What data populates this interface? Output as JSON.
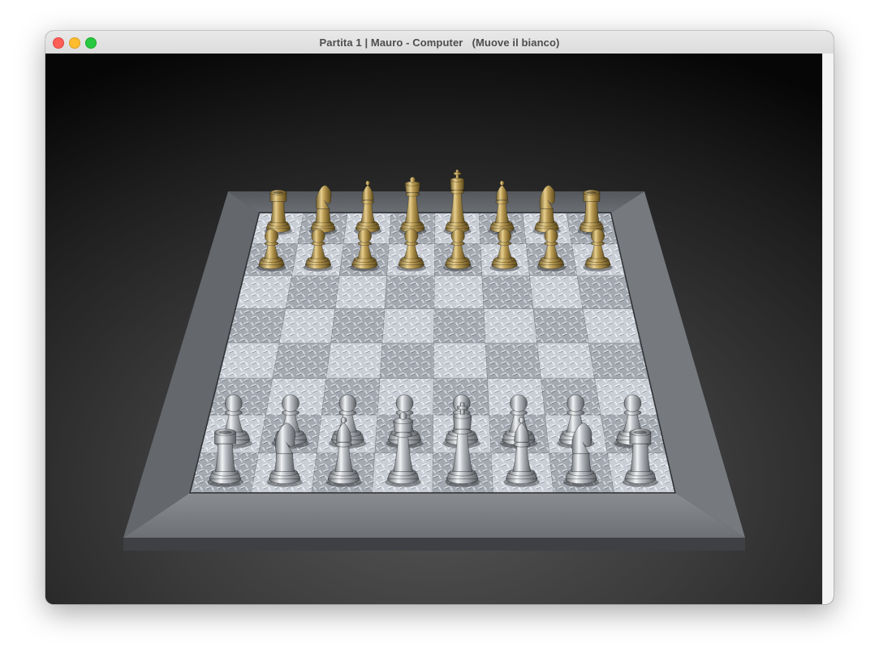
{
  "window": {
    "title": "Partita 1 | Mauro - Computer   (Muove il bianco)",
    "buttons": {
      "close": "close-icon",
      "minimize": "minimize-icon",
      "zoom": "zoom-icon"
    }
  },
  "board": {
    "rows": 8,
    "cols": 8,
    "frame_color": "#6b6e73",
    "light_square_color": "#c9ced6",
    "dark_square_color": "#9fa4ad"
  },
  "pieces": {
    "black": {
      "color": "#b99a52",
      "back_rank": [
        "rook",
        "knight",
        "bishop",
        "queen",
        "king",
        "bishop",
        "knight",
        "rook"
      ],
      "pawns": [
        "pawn",
        "pawn",
        "pawn",
        "pawn",
        "pawn",
        "pawn",
        "pawn",
        "pawn"
      ]
    },
    "white": {
      "color": "#c3c6ca",
      "back_rank": [
        "rook",
        "knight",
        "bishop",
        "queen",
        "king",
        "bishop",
        "knight",
        "rook"
      ],
      "pawns": [
        "pawn",
        "pawn",
        "pawn",
        "pawn",
        "pawn",
        "pawn",
        "pawn",
        "pawn"
      ]
    }
  }
}
